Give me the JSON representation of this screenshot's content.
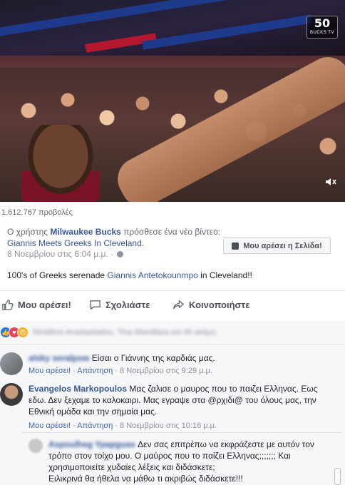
{
  "video": {
    "logo_number": "50",
    "logo_text": "BUCKS TV",
    "volume_icon": "speaker-mute-icon"
  },
  "views": "1.612.767 προβολές",
  "post": {
    "meta_prefix": "Ο χρήστης",
    "page_name": "Milwaukee Bucks",
    "meta_middle": "πρόσθεσε ένα νέο βίντεο:",
    "video_title": "Giannis Meets Greeks In Cleveland",
    "meta_suffix": ".",
    "date": "8 Νοεμβρίου στις 6:04 μ.μ. ·",
    "like_page_label": "Μου αρέσει η Σελίδα!",
    "text_before": "100's of Greeks serenade",
    "text_link": "Giannis Antetokounmpo",
    "text_after": "in Cleveland!!"
  },
  "actions": {
    "like": "Μου αρέσει!",
    "comment": "Σχολιάστε",
    "share": "Κοινοποιήστε"
  },
  "reactions": {
    "names": "Ntratikos Anastasiadou, Tina Mandilara και 46 ακόμη"
  },
  "comments": [
    {
      "name": "alsky seralpow",
      "text": "Είσαι ο Γιάννης της καρδιάς μας.",
      "like": "Μου αρέσει!",
      "reply": "Απάντηση",
      "date": "8 Νοεμβρίου στις 9:29 μ.μ."
    },
    {
      "name": "Evangelos Markopoulos",
      "text": "Μας ζαλισε ο μαυρος που το παιζει Ελληνας. Εως εδω. Δεν ξεχαμε το καλοκαιρι. Μας εγραψε στα @ρχιδι@ του όλους μας, την Εθνική ομάδα και την σημαία μας.",
      "like": "Μου αρέσει!",
      "reply": "Απάντηση",
      "date": "8 Νοεμβρίου στις 10:16 μ.μ."
    },
    {
      "name": "Aspoulheg Ypapguas",
      "text": "Δεν σας επιτρέπω να εκφράζεστε με αυτόν τον τρόπο στον τοίχο μου. Ο μαύρος που το παίζει Ελληνας;;;;;;; Και χρησιμοποιείτε χυδαίες λέξεις και διδάσκετε;\nΕιλικρινά θα ήθελα να μάθω τι ακριβώς διδάσκετε!!!"
    }
  ],
  "colors": {
    "link": "#365899",
    "meta": "#90949c",
    "like_blue": "#1877f2"
  }
}
